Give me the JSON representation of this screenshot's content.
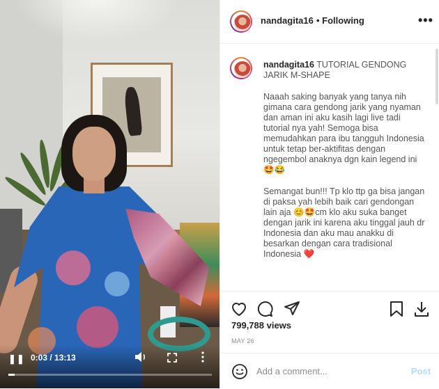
{
  "video": {
    "current_time": "0:03",
    "duration": "13:13",
    "time_text": "0:03 / 13:13",
    "progress_fraction": 0.004
  },
  "header": {
    "username": "nandagita16",
    "following": "• Following"
  },
  "caption": {
    "username": "nandagita16",
    "title": "TUTORIAL GENDONG JARIK M-SHAPE",
    "paragraph1": "Naaah saking banyak yang tanya nih gimana cara gendong jarik yang nyaman dan aman ini aku kasih lagi live tadi tutorial nya yah! Semoga bisa memudahkan para ibu tangguh Indonesia untuk tetap ber-aktifitas dengan ngegembol anaknya dgn kain legend ini 🤩😂",
    "paragraph2": "Semangat bun!!! Tp klo ttp ga bisa jangan di paksa yah lebih baik cari gendongan lain aja 😊🤩cm klo aku suka banget dengan jarik ini karena aku tinggal jauh dr Indonesia dan aku mau anakku di besarkan dengan cara tradisional Indonesia ❤️"
  },
  "stats": {
    "views": "799,788 views",
    "date": "MAY 26"
  },
  "comment": {
    "placeholder": "Add a comment...",
    "post_label": "Post"
  },
  "icons": {
    "like": "heart-icon",
    "comment": "comment-icon",
    "share": "share-icon",
    "save": "bookmark-icon",
    "download": "download-icon",
    "emoji": "smile-icon"
  },
  "colors": {
    "post_disabled": "#b2dffc",
    "dress": "#2a66b8"
  }
}
